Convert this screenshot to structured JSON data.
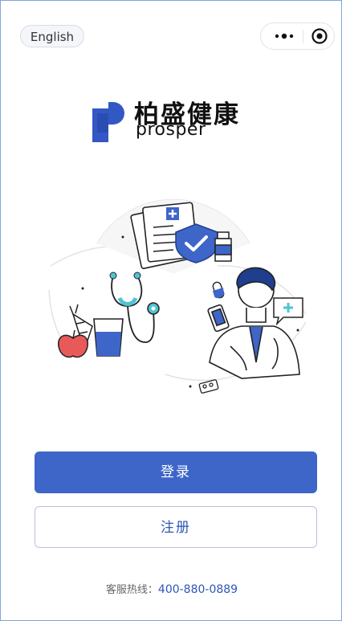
{
  "topbar": {
    "language_label": "English"
  },
  "brand": {
    "name_cn": "柏盛健康",
    "name_en": "prosper",
    "colors": {
      "primary_blue": "#3e66c9",
      "logo_blue": "#3358c4"
    }
  },
  "icons": {
    "more": "more-dots-icon",
    "close": "target-close-icon"
  },
  "actions": {
    "login_label": "登录",
    "register_label": "注册"
  },
  "footer": {
    "hotline_label": "客服热线：",
    "hotline_number": "400-880-0889"
  }
}
